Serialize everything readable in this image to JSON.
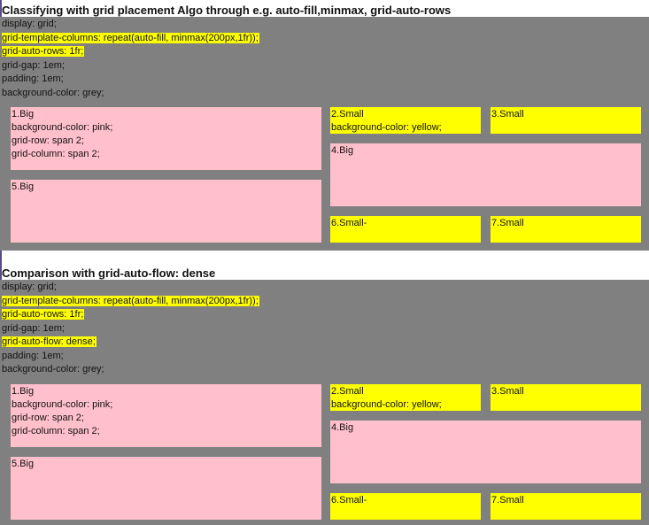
{
  "section1": {
    "title": "Classifying with grid placement Algo through e.g. auto-fill,minmax, grid-auto-rows",
    "code": [
      {
        "text": "display: grid;",
        "highlight": false
      },
      {
        "text": "grid-template-columns: repeat(auto-fill, minmax(200px,1fr));",
        "highlight": true
      },
      {
        "text": "grid-auto-rows: 1fr;",
        "highlight": true
      },
      {
        "text": "grid-gap: 1em;",
        "highlight": false
      },
      {
        "text": "padding: 1em;",
        "highlight": false
      },
      {
        "text": "background-color: grey;",
        "highlight": false
      }
    ],
    "items": {
      "item1": [
        "1.Big",
        "background-color: pink;",
        "grid-row: span 2;",
        "grid-column: span 2;"
      ],
      "item2": [
        "2.Small",
        "background-color: yellow;"
      ],
      "item3": [
        "3.Small"
      ],
      "item4": [
        "4.Big"
      ],
      "item5": [
        "5.Big"
      ],
      "item6": [
        "6.Small-"
      ],
      "item7": [
        "7.Small"
      ]
    }
  },
  "section2": {
    "title": "Comparison with grid-auto-flow: dense",
    "code": [
      {
        "text": "display: grid;",
        "highlight": false
      },
      {
        "text": "grid-template-columns: repeat(auto-fill, minmax(200px,1fr));",
        "highlight": true
      },
      {
        "text": "grid-auto-rows: 1fr;",
        "highlight": true
      },
      {
        "text": "grid-gap: 1em;",
        "highlight": false
      },
      {
        "text": "grid-auto-flow: dense;",
        "highlight": true
      },
      {
        "text": "padding: 1em;",
        "highlight": false
      },
      {
        "text": "background-color: grey;",
        "highlight": false
      }
    ],
    "items": {
      "item1": [
        "1.Big",
        "background-color: pink;",
        "grid-row: span 2;",
        "grid-column: span 2;"
      ],
      "item2": [
        "2.Small",
        "background-color: yellow;"
      ],
      "item3": [
        "3.Small"
      ],
      "item4": [
        "4.Big"
      ],
      "item5": [
        "5.Big"
      ],
      "item6": [
        "6.Small-"
      ],
      "item7": [
        "7.Small"
      ]
    }
  },
  "colors": {
    "panel": "#808080",
    "big": "#ffc0cb",
    "small": "#ffff00",
    "highlight": "#ffff00"
  }
}
